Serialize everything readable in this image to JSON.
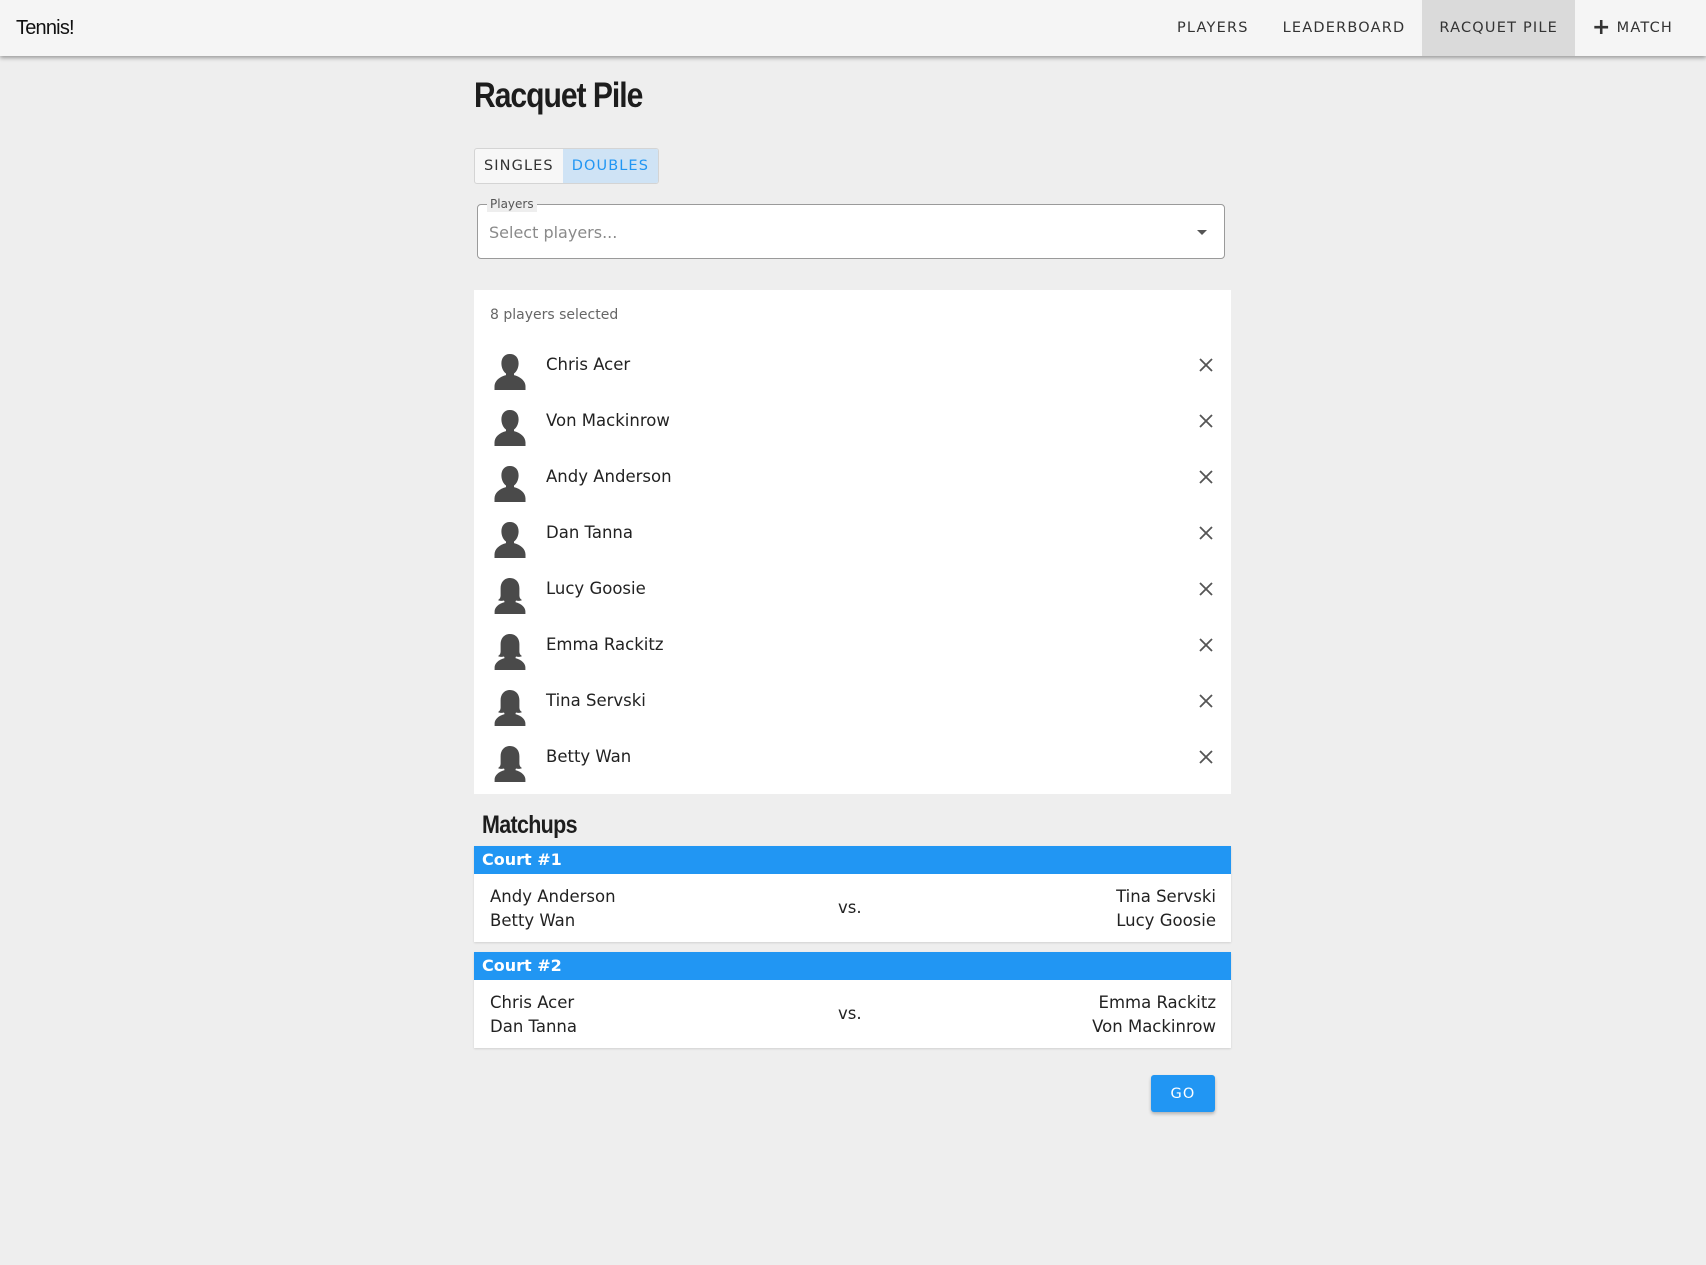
{
  "app": {
    "brand": "Tennis!"
  },
  "nav": {
    "items": [
      {
        "label": "PLAYERS"
      },
      {
        "label": "LEADERBOARD"
      },
      {
        "label": "RACQUET PILE",
        "active": true
      },
      {
        "label": "MATCH",
        "icon": "plus-icon"
      }
    ]
  },
  "page": {
    "title": "Racquet Pile"
  },
  "mode_toggle": {
    "options": [
      {
        "label": "SINGLES"
      },
      {
        "label": "DOUBLES",
        "active": true
      }
    ]
  },
  "player_select": {
    "legend": "Players",
    "placeholder": "Select players..."
  },
  "selected_players": {
    "count_text": "8 players selected",
    "players": [
      {
        "name": "Chris Acer",
        "avatar": "male-avatar-icon"
      },
      {
        "name": "Von Mackinrow",
        "avatar": "male-avatar-icon"
      },
      {
        "name": "Andy Anderson",
        "avatar": "male-avatar-icon"
      },
      {
        "name": "Dan Tanna",
        "avatar": "male-avatar-icon"
      },
      {
        "name": "Lucy Goosie",
        "avatar": "female-avatar-icon"
      },
      {
        "name": "Emma Rackitz",
        "avatar": "female-avatar-icon"
      },
      {
        "name": "Tina Servski",
        "avatar": "female-avatar-icon"
      },
      {
        "name": "Betty Wan",
        "avatar": "female-avatar-icon"
      }
    ]
  },
  "matchups": {
    "title": "Matchups",
    "vs_label": "vs.",
    "courts": [
      {
        "label": "Court #1",
        "team_a": [
          "Andy Anderson",
          "Betty Wan"
        ],
        "team_b": [
          "Tina Servski",
          "Lucy Goosie"
        ]
      },
      {
        "label": "Court #2",
        "team_a": [
          "Chris Acer",
          "Dan Tanna"
        ],
        "team_b": [
          "Emma Rackitz",
          "Von Mackinrow"
        ]
      }
    ]
  },
  "actions": {
    "go_label": "GO"
  },
  "colors": {
    "accent": "#2196f3",
    "toggle_active_bg": "#cfe3f5",
    "page_bg": "#eeeeee",
    "nav_active_bg": "#dadada",
    "avatar": "#4a4a4a"
  }
}
